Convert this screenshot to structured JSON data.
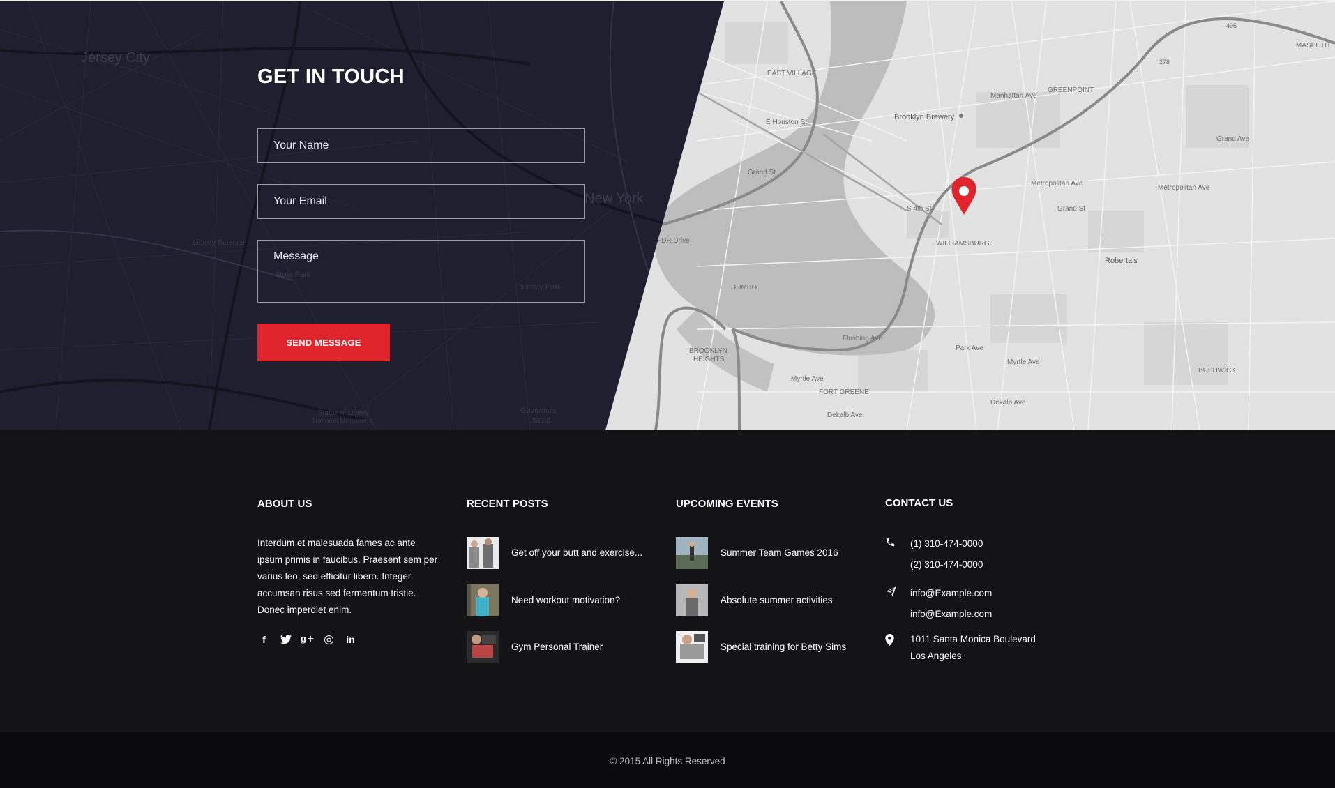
{
  "contact": {
    "title": "GET IN TOUCH",
    "name_placeholder": "Your Name",
    "email_placeholder": "Your Email",
    "message_placeholder": "Message",
    "send_label": "SEND MESSAGE",
    "accent_color": "#e0262c"
  },
  "map": {
    "pin_color": "#e0262c",
    "labels": {
      "jersey_city": "Jersey City",
      "new_york": "New York",
      "liberty_science": "Liberty Science",
      "state_park": "State Park",
      "battery_park": "Battery Park",
      "statue_of_liberty": "Statue of Liberty",
      "national_monument": "National Monument",
      "governors": "Governors",
      "island": "Island",
      "east_village": "EAST VILLAGE",
      "brooklyn_brewery": "Brooklyn Brewery",
      "greenpoint": "GREENPOINT",
      "williamsburg": "WILLIAMSBURG",
      "dumbo": "DUMBO",
      "brooklyn": "BROOKLYN",
      "heights": "HEIGHTS",
      "fort_greene": "FORT GREENE",
      "bushwick": "BUSHWICK",
      "robertas": "Roberta's",
      "metropolitan_ave": "Metropolitan Ave",
      "grand_st": "Grand St",
      "flushing_ave": "Flushing Ave",
      "myrtle_ave": "Myrtle Ave",
      "dekalb_ave": "Dekalb Ave",
      "park_ave": "Park Ave",
      "e_houston_st": "E Houston St",
      "s_4th_st": "S 4th St",
      "fdr_drive": "FDR Drive",
      "grand_ave": "Grand Ave",
      "manhattan_ave": "Manhattan Ave",
      "route_278": "278",
      "route_495": "495",
      "maspeth": "MASPETH"
    }
  },
  "footer": {
    "about": {
      "title": "ABOUT US",
      "text": "Interdum et malesuada fames ac ante ipsum primis in faucibus. Praesent sem per varius leo, sed efficitur libero. Integer accumsan risus sed fermentum tristie. Donec imperdiet enim."
    },
    "social": {
      "facebook_glyph": "f",
      "twitter_glyph": "🐦",
      "googleplus_glyph": "g+",
      "dribbble_glyph": "◎",
      "linkedin_glyph": "in"
    },
    "posts": {
      "title": "RECENT POSTS",
      "items": [
        {
          "title": "Get off your butt and exercise...",
          "icon": "post-thumbnail-icon"
        },
        {
          "title": "Need workout motivation?",
          "icon": "post-thumbnail-icon"
        },
        {
          "title": "Gym Personal Trainer",
          "icon": "post-thumbnail-icon"
        }
      ]
    },
    "events": {
      "title": "UPCOMING EVENTS",
      "items": [
        {
          "title": "Summer Team Games 2016",
          "icon": "event-thumbnail-icon"
        },
        {
          "title": "Absolute summer activities",
          "icon": "event-thumbnail-icon"
        },
        {
          "title": "Special training for Betty Sims",
          "icon": "event-thumbnail-icon"
        }
      ]
    },
    "contact": {
      "title": "CONTACT US",
      "phone1": "(1) 310-474-0000",
      "phone2": "(2) 310-474-0000",
      "email1": "info@Example.com",
      "email2": "info@Example.com",
      "address1": "1011 Santa Monica Boulevard",
      "address2": "Los Angeles"
    },
    "copyright": "© 2015 All Rights Reserved"
  }
}
